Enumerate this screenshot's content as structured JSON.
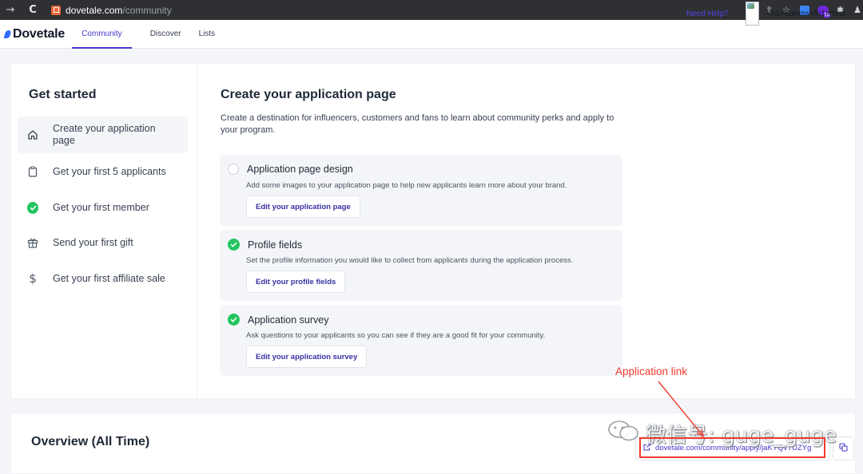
{
  "browser": {
    "url_host": "dovetale.com",
    "url_path": "/community",
    "nav_back_icon": "arrow-right-icon",
    "reload_icon": "reload-icon"
  },
  "app": {
    "logo_text": "Dovetale",
    "tabs": [
      {
        "label": "Community",
        "active": true
      },
      {
        "label": "Discover",
        "active": false
      },
      {
        "label": "Lists",
        "active": false
      }
    ],
    "help_label": "Need Help?",
    "user_name": "<h1>kunxss</h1>\"test"
  },
  "sidebar": {
    "title": "Get started",
    "steps": [
      {
        "label": "Create your application page",
        "icon": "home-icon",
        "active": true
      },
      {
        "label": "Get your first 5 applicants",
        "icon": "clipboard-icon",
        "active": false
      },
      {
        "label": "Get your first member",
        "icon": "check-circle-icon",
        "active": false
      },
      {
        "label": "Send your first gift",
        "icon": "gift-icon",
        "active": false
      },
      {
        "label": "Get your first affiliate sale",
        "icon": "dollar-icon",
        "active": false
      }
    ]
  },
  "content": {
    "title": "Create your application page",
    "description": "Create a destination for influencers, customers and fans to learn about community perks and apply to your program.",
    "tasks": [
      {
        "title": "Application page design",
        "description": "Add some images to your application page to help new applicants learn more about your brand.",
        "button": "Edit your application page",
        "complete": false
      },
      {
        "title": "Profile fields",
        "description": "Set the profile information you would like to collect from applicants during the application process.",
        "button": "Edit your profile fields",
        "complete": true
      },
      {
        "title": "Application survey",
        "description": "Ask questions to your applicants so you can see if they are a good fit for your community.",
        "button": "Edit your application survey",
        "complete": true
      }
    ]
  },
  "overview": {
    "title": "Overview (All Time)",
    "app_link": "dovetale.com/community/apply/jaKYQvTUZYg"
  },
  "annotation": {
    "label": "Application link",
    "color": "#ef3b2c"
  },
  "watermark": {
    "text": "微信号: guge_guge"
  },
  "colors": {
    "accent": "#4338ca",
    "success": "#22c55e",
    "page_bg": "#f3f5f8"
  }
}
